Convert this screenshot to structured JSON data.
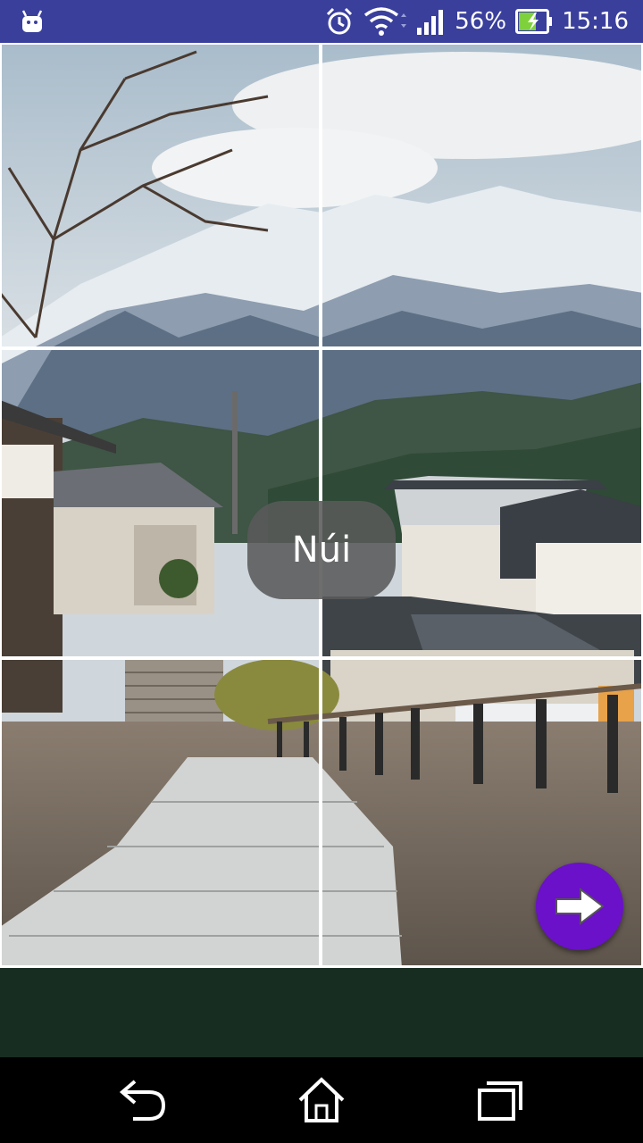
{
  "status_bar": {
    "battery_percent": "56%",
    "time": "15:16",
    "icons": [
      "android-icon",
      "alarm-icon",
      "wifi-icon",
      "signal-icon",
      "battery-charging-icon"
    ]
  },
  "puzzle": {
    "caption": "Núi",
    "grid": {
      "rows": 3,
      "columns": 2
    },
    "next_icon": "arrow-right-icon"
  },
  "colors": {
    "status_bar": "#3a3f9c",
    "next_button": "#6a11c9",
    "bottom_panel": "#182d22",
    "caption_bg": "#5a5a5a"
  },
  "nav_bar": {
    "icons": [
      "back-icon",
      "home-icon",
      "recents-icon"
    ]
  }
}
